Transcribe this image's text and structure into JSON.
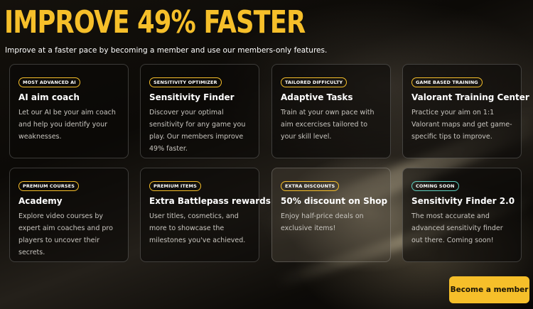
{
  "hero": {
    "headline": "IMPROVE 49% FASTER",
    "subline": "Improve at a faster pace by becoming a member and use our members-only features."
  },
  "cards": [
    {
      "badge": "MOST ADVANCED AI",
      "title": "AI aim coach",
      "desc": "Let our AI be your aim coach and help you identify your weaknesses."
    },
    {
      "badge": "SENSITIVITY OPTIMIZER",
      "title": "Sensitivity Finder",
      "desc": "Discover your optimal sensitivity for any game you play. Our members improve 49% faster."
    },
    {
      "badge": "TAILORED DIFFICULTY",
      "title": "Adaptive Tasks",
      "desc": "Train at your own pace with aim excercises tailored to your skill level."
    },
    {
      "badge": "GAME BASED TRAINING",
      "title": "Valorant Training Center",
      "desc": "Practice your aim on 1:1 Valorant maps and get game-specific tips to improve."
    },
    {
      "badge": "PREMIUM COURSES",
      "title": "Academy",
      "desc": "Explore video courses by expert aim coaches and pro players to uncover their secrets."
    },
    {
      "badge": "PREMIUM ITEMS",
      "title": "Extra Battlepass rewards",
      "desc": "User titles, cosmetics, and more to showcase the milestones you've achieved."
    },
    {
      "badge": "EXTRA DISCOUNTS",
      "title": "50% discount on Shop",
      "desc": "Enjoy half-price deals on exclusive items!"
    },
    {
      "badge": "COMING SOON",
      "title": "Sensitivity Finder 2.0",
      "desc": "The most accurate and advanced sensitivity finder out there. Coming soon!"
    }
  ],
  "cta": {
    "label": "Become a member"
  },
  "colors": {
    "accent": "#f6bf2a",
    "teal_badge": "#5fd0c0",
    "background": "#0b0906"
  }
}
